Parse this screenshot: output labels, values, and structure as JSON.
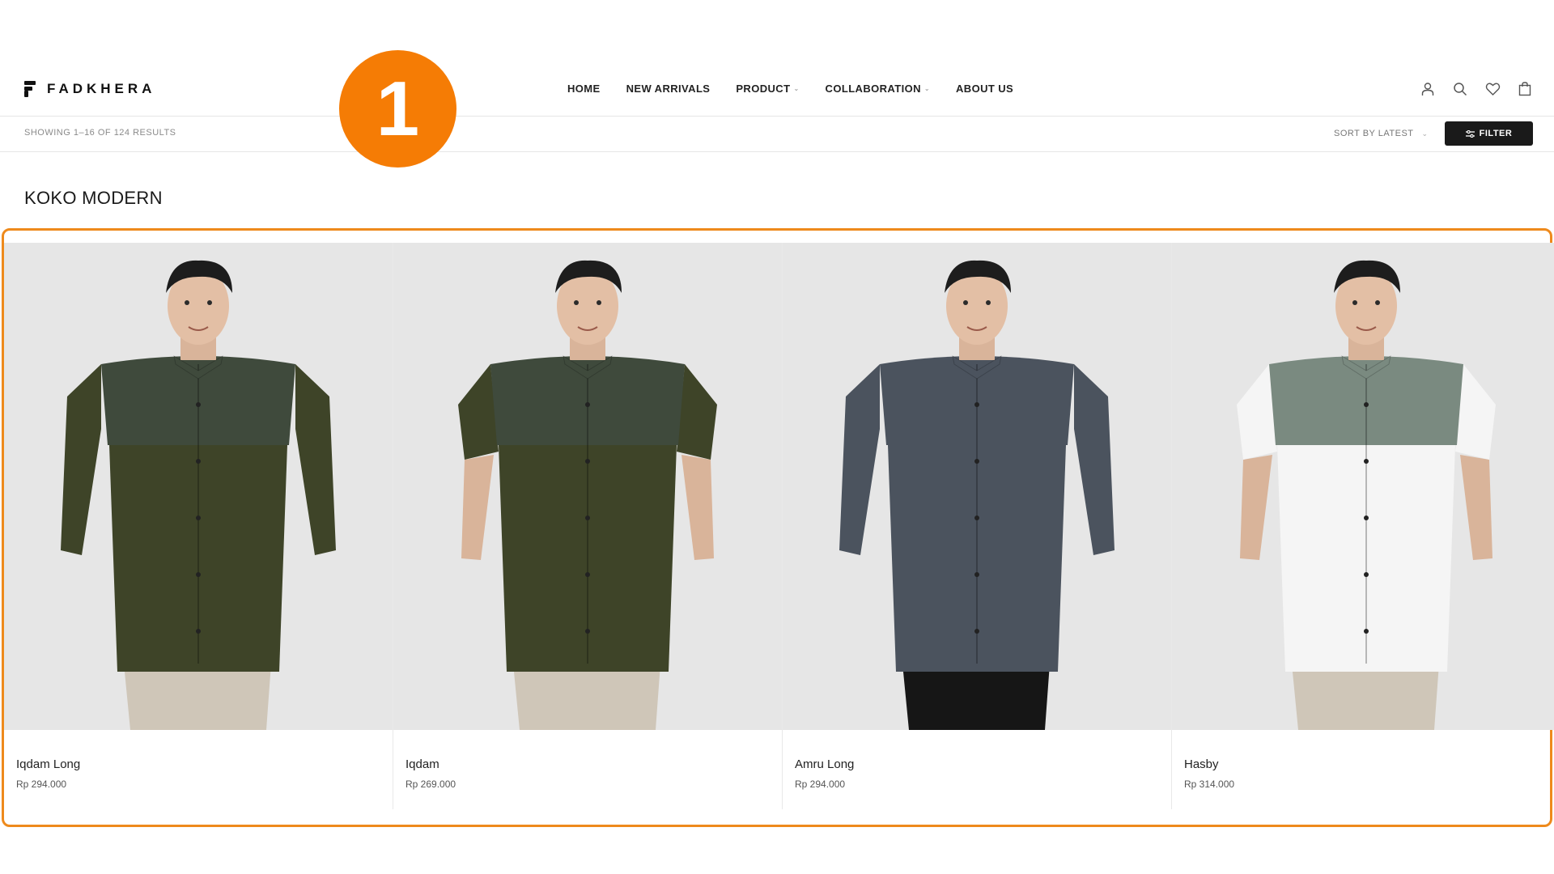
{
  "brand": {
    "name": "FADKHERA"
  },
  "nav": [
    {
      "label": "HOME",
      "has_dropdown": false
    },
    {
      "label": "NEW ARRIVALS",
      "has_dropdown": false
    },
    {
      "label": "PRODUCT",
      "has_dropdown": true
    },
    {
      "label": "COLLABORATION",
      "has_dropdown": true
    },
    {
      "label": "ABOUT US",
      "has_dropdown": false
    }
  ],
  "header_icons": [
    "user-icon",
    "search-icon",
    "heart-icon",
    "shopping-bag-icon"
  ],
  "toolbar": {
    "results_text": "SHOWING 1–16 OF 124 RESULTS",
    "sort_label": "SORT BY LATEST",
    "filter_label": "FILTER"
  },
  "step_badge": "1",
  "page_title": "KOKO MODERN",
  "products": [
    {
      "name": "Iqdam Long",
      "price": "Rp 294.000",
      "shirt_top": "#3f4a3c",
      "shirt_bottom": "#3e4428",
      "pants": "#cfc6b8",
      "sleeve": "long"
    },
    {
      "name": "Iqdam",
      "price": "Rp 269.000",
      "shirt_top": "#3f4a3c",
      "shirt_bottom": "#3e4428",
      "pants": "#cfc6b8",
      "sleeve": "short"
    },
    {
      "name": "Amru Long",
      "price": "Rp 294.000",
      "shirt_top": "#4b535e",
      "shirt_bottom": "#4b535e",
      "pants": "#161616",
      "sleeve": "long"
    },
    {
      "name": "Hasby",
      "price": "Rp 314.000",
      "shirt_top": "#7a8a80",
      "shirt_bottom": "#f5f5f5",
      "pants": "#cfc6b8",
      "sleeve": "short"
    }
  ],
  "colors": {
    "accent": "#f57c05",
    "frame": "#ee8a1c",
    "button": "#1a1a1a"
  }
}
